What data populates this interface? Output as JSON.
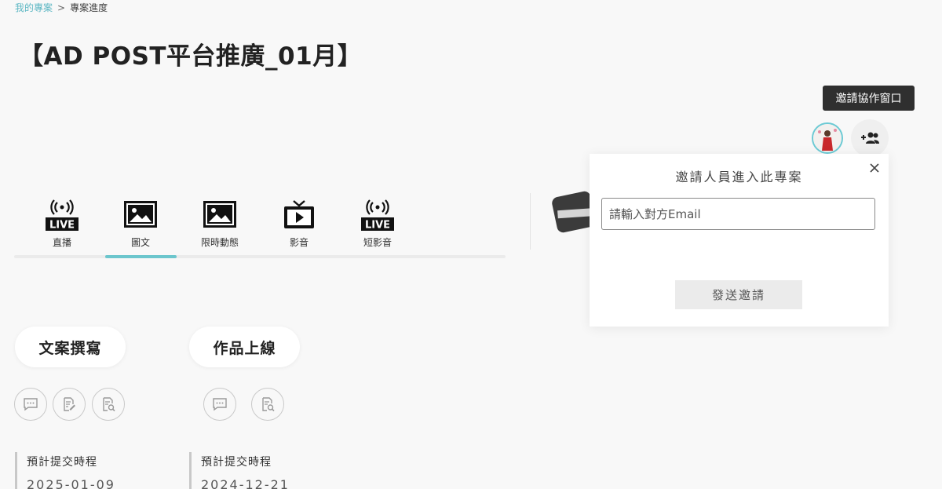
{
  "breadcrumb": {
    "parent": "我的專案",
    "separator": ">",
    "current": "專案進度"
  },
  "page": {
    "title": "【AD POST平台推廣_01月】"
  },
  "tooltip": {
    "text": "邀請協作窗口"
  },
  "tabs": [
    {
      "label": "直播",
      "icon": "live-icon"
    },
    {
      "label": "圖文",
      "icon": "image-icon"
    },
    {
      "label": "限時動態",
      "icon": "image-icon"
    },
    {
      "label": "影音",
      "icon": "tv-play-icon"
    },
    {
      "label": "短影音",
      "icon": "live-icon"
    }
  ],
  "live_badge": "LIVE",
  "active_tab": "圖文",
  "popup": {
    "title": "邀請人員進入此專案",
    "input_placeholder": "請輸入對方Email",
    "submit_label": "發送邀請"
  },
  "stages": [
    {
      "label": "文案撰寫",
      "deadline_label": "預計提交時程",
      "deadline_date": "2025-01-09"
    },
    {
      "label": "作品上線",
      "deadline_label": "預計提交時程",
      "deadline_date": "2024-12-21"
    }
  ],
  "colors": {
    "accent": "#6cc6cd",
    "link": "#5fb8c4",
    "tooltip_bg": "#2f2f2f"
  }
}
